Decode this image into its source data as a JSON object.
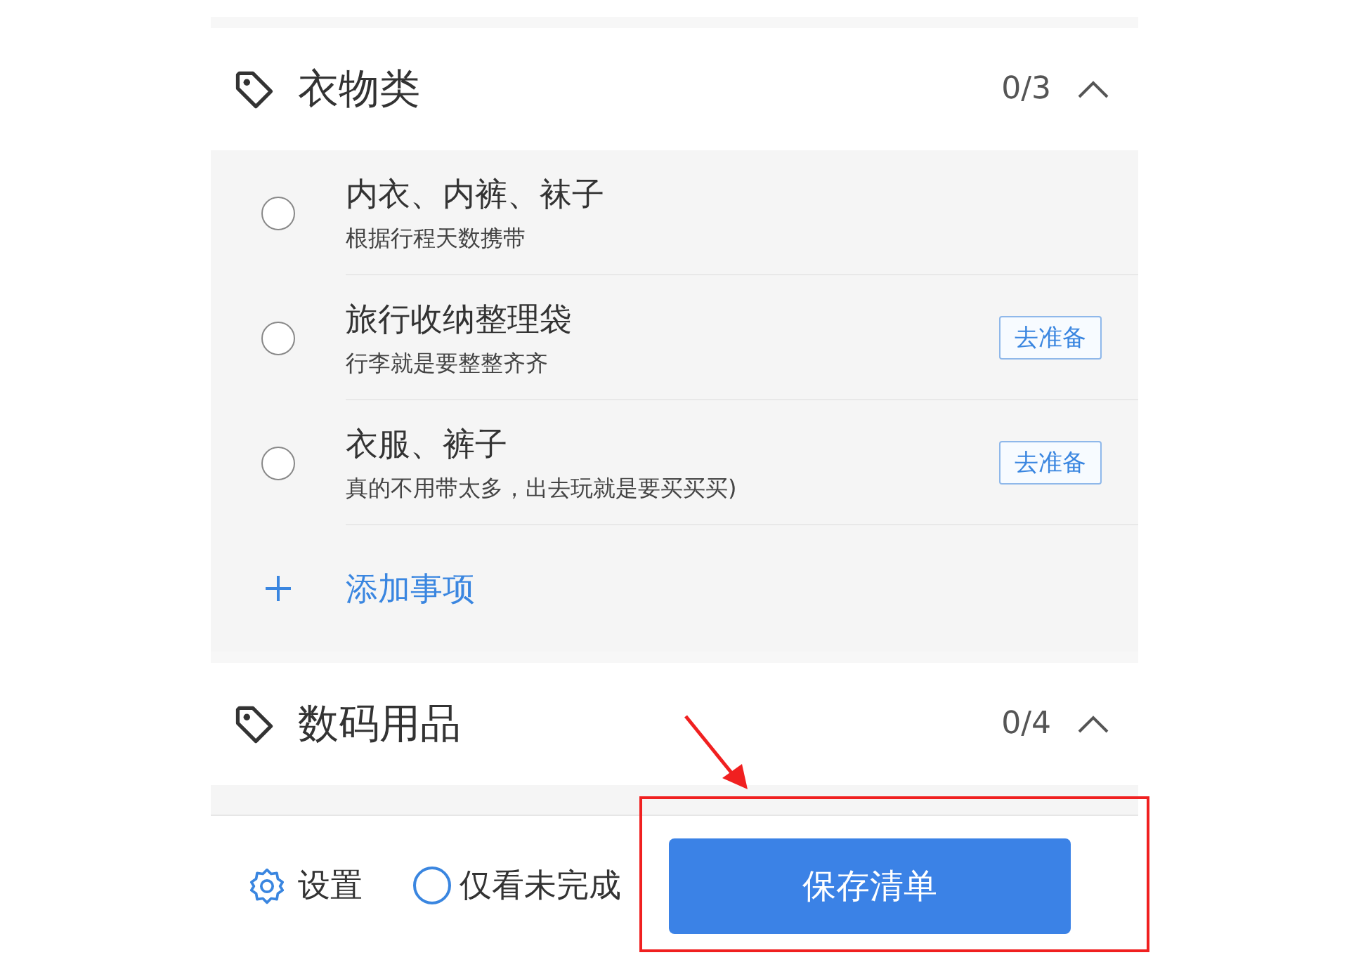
{
  "sections": [
    {
      "title": "衣物类",
      "count": "0/3",
      "expanded": true,
      "items": [
        {
          "name": "内衣、内裤、袜子",
          "note": "根据行程天数携带",
          "checked": false
        },
        {
          "name": "旅行收纳整理袋",
          "note": "行李就是要整整齐齐",
          "checked": false,
          "action": "去准备"
        },
        {
          "name": "衣服、裤子",
          "note": "真的不用带太多，出去玩就是要买买买)",
          "checked": false,
          "action": "去准备"
        }
      ],
      "add_label": "添加事项"
    },
    {
      "title": "数码用品",
      "count": "0/4",
      "expanded": true
    }
  ],
  "bottom_bar": {
    "settings": "设置",
    "filter": {
      "label": "仅看未完成",
      "checked": false
    },
    "save": "保存清单"
  },
  "annotation": {
    "kind": "highlight"
  }
}
